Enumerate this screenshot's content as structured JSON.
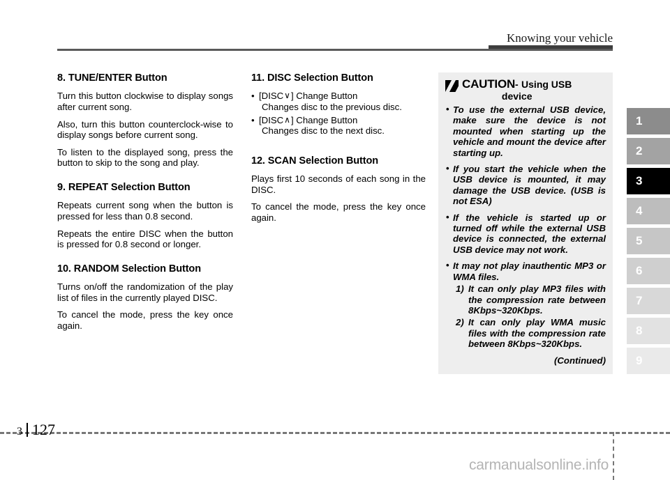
{
  "header": {
    "title": "Knowing your vehicle"
  },
  "footer": {
    "chapter": "3",
    "page": "127",
    "watermark": "carmanualsonline.info"
  },
  "chapter_tabs": {
    "active": "3",
    "items": [
      {
        "label": "1",
        "color": "#8c8c8c",
        "active": false
      },
      {
        "label": "2",
        "color": "#a3a3a3",
        "active": false
      },
      {
        "label": "3",
        "color": "#000000",
        "active": true
      },
      {
        "label": "4",
        "color": "#bdbdbd",
        "active": false
      },
      {
        "label": "5",
        "color": "#c6c6c6",
        "active": false
      },
      {
        "label": "6",
        "color": "#cfcfcf",
        "active": false
      },
      {
        "label": "7",
        "color": "#d8d8d8",
        "active": false
      },
      {
        "label": "8",
        "color": "#e2e2e2",
        "active": false
      },
      {
        "label": "9",
        "color": "#eaeaea",
        "active": false
      }
    ]
  },
  "left_column": {
    "section8": {
      "heading": "8. TUNE/ENTER Button",
      "paragraphs": [
        "Turn this button clockwise to display songs after current song.",
        "Also, turn this button counterclock-wise to display songs before current song.",
        "To listen to the displayed song, press the button to skip to the song and play."
      ]
    },
    "section9": {
      "heading": "9. REPEAT Selection Button",
      "paragraphs": [
        "Repeats current song when the button is pressed for less than 0.8 second.",
        "Repeats the entire DISC when the button is pressed for 0.8 second or longer."
      ]
    },
    "section10": {
      "heading": "10. RANDOM Selection Button",
      "paragraphs": [
        "Turns on/off the randomization of the play list of files in the currently played DISC.",
        "To cancel the mode, press the key once again."
      ]
    }
  },
  "middle_column": {
    "section11": {
      "heading": "11. DISC Selection Button",
      "bullets": [
        {
          "prefix": "[DISC",
          "chevron": "∨",
          "suffix": "] Change Button",
          "detail": "Changes disc to the previous disc."
        },
        {
          "prefix": "[DISC",
          "chevron": "∧",
          "suffix": "] Change Button",
          "detail": "Changes disc to the next disc."
        }
      ]
    },
    "section12": {
      "heading": "12. SCAN Selection Button",
      "paragraphs": [
        "Plays first 10 seconds of each song in the DISC.",
        "To cancel the mode, press the key once again."
      ]
    }
  },
  "caution": {
    "icon": "warning-slash-icon",
    "title": "CAUTION",
    "dash": "-",
    "subject_line1": "Using USB",
    "subject_line2": "device",
    "bullet_char": "•",
    "items": [
      "To use the external USB device, make sure the device is not mounted when starting up the vehicle and mount the device after starting up.",
      "If you start the vehicle when the USB device is mounted, it may damage the USB device. (USB is not ESA)",
      "If the vehicle is started up or turned off while the external USB device is connected, the external USB device may not work."
    ],
    "last_item": "It may not play inauthentic MP3 or WMA files.",
    "sub_items": [
      {
        "num": "1)",
        "text": "It can only play MP3 files with the compression rate between 8Kbps~320Kbps."
      },
      {
        "num": "2)",
        "text": "It can only play WMA music files with the compression rate between 8Kbps~320Kbps."
      }
    ],
    "continued": "(Continued)",
    "background": "#eeeeee"
  }
}
